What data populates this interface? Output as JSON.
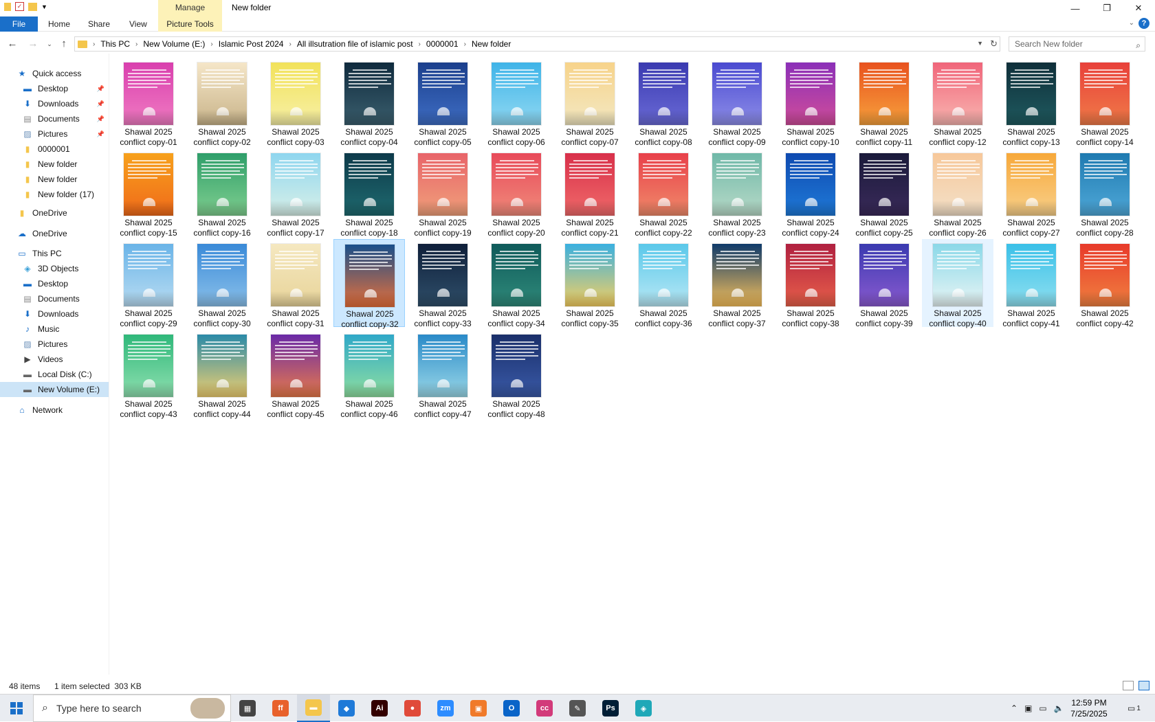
{
  "window": {
    "title": "New folder",
    "manage_label": "Manage",
    "controls": {
      "minimize": "—",
      "maximize": "❐",
      "close": "✕"
    }
  },
  "ribbon": {
    "tabs": [
      "File",
      "Home",
      "Share",
      "View"
    ],
    "picture_tools": "Picture Tools"
  },
  "address": {
    "segments": [
      "This PC",
      "New Volume (E:)",
      "Islamic Post 2024",
      "All illsutration file of islamic post",
      "0000001",
      "New folder"
    ]
  },
  "search": {
    "placeholder": "Search New folder"
  },
  "sidebar": {
    "items": [
      {
        "label": "Quick access",
        "icon": "star-icon",
        "pinned": false,
        "indent": 0
      },
      {
        "label": "Desktop",
        "icon": "desktop-icon",
        "pinned": true,
        "indent": 1
      },
      {
        "label": "Downloads",
        "icon": "download-icon",
        "pinned": true,
        "indent": 1
      },
      {
        "label": "Documents",
        "icon": "documents-icon",
        "pinned": true,
        "indent": 1
      },
      {
        "label": "Pictures",
        "icon": "pictures-icon",
        "pinned": true,
        "indent": 1
      },
      {
        "label": "0000001",
        "icon": "folder-icon",
        "pinned": false,
        "indent": 1
      },
      {
        "label": "New folder",
        "icon": "folder-icon",
        "pinned": false,
        "indent": 1
      },
      {
        "label": "New folder",
        "icon": "folder-icon",
        "pinned": false,
        "indent": 1
      },
      {
        "label": "New folder (17)",
        "icon": "folder-icon",
        "pinned": false,
        "indent": 1
      },
      {
        "label": "OneDrive",
        "icon": "folder-icon",
        "pinned": false,
        "indent": 0
      },
      {
        "label": "OneDrive",
        "icon": "cloud-icon",
        "pinned": false,
        "indent": 0
      },
      {
        "label": "This PC",
        "icon": "computer-icon",
        "pinned": false,
        "indent": 0
      },
      {
        "label": "3D Objects",
        "icon": "cube-icon",
        "pinned": false,
        "indent": 1
      },
      {
        "label": "Desktop",
        "icon": "desktop-icon",
        "pinned": false,
        "indent": 1
      },
      {
        "label": "Documents",
        "icon": "documents-icon",
        "pinned": false,
        "indent": 1
      },
      {
        "label": "Downloads",
        "icon": "download-icon",
        "pinned": false,
        "indent": 1
      },
      {
        "label": "Music",
        "icon": "music-icon",
        "pinned": false,
        "indent": 1
      },
      {
        "label": "Pictures",
        "icon": "pictures-icon",
        "pinned": false,
        "indent": 1
      },
      {
        "label": "Videos",
        "icon": "video-icon",
        "pinned": false,
        "indent": 1
      },
      {
        "label": "Local Disk (C:)",
        "icon": "drive-icon",
        "pinned": false,
        "indent": 1
      },
      {
        "label": "New Volume (E:)",
        "icon": "drive-icon",
        "pinned": false,
        "indent": 1
      },
      {
        "label": "Network",
        "icon": "network-icon",
        "pinned": false,
        "indent": 0
      }
    ],
    "selected_index": 20
  },
  "files": {
    "line1": "Shawal 2025",
    "names": [
      "conflict copy-01",
      "conflict copy-02",
      "conflict copy-03",
      "conflict copy-04",
      "conflict copy-05",
      "conflict copy-06",
      "conflict copy-07",
      "conflict copy-08",
      "conflict copy-09",
      "conflict copy-10",
      "conflict copy-11",
      "conflict copy-12",
      "conflict copy-13",
      "conflict copy-14",
      "conflict copy-15",
      "conflict copy-16",
      "conflict copy-17",
      "conflict copy-18",
      "conflict copy-19",
      "conflict copy-20",
      "conflict copy-21",
      "conflict copy-22",
      "conflict copy-23",
      "conflict copy-24",
      "conflict copy-25",
      "conflict copy-26",
      "conflict copy-27",
      "conflict copy-28",
      "conflict copy-29",
      "conflict copy-30",
      "conflict copy-31",
      "conflict copy-32",
      "conflict copy-33",
      "conflict copy-34",
      "conflict copy-35",
      "conflict copy-36",
      "conflict copy-37",
      "conflict copy-38",
      "conflict copy-39",
      "conflict copy-40",
      "conflict copy-41",
      "conflict copy-42",
      "conflict copy-43",
      "conflict copy-44",
      "conflict copy-45",
      "conflict copy-46",
      "conflict copy-47",
      "conflict copy-48"
    ],
    "colors": [
      [
        "#d93fae",
        "#f07bc2"
      ],
      [
        "#f5e6c8",
        "#c9b48a"
      ],
      [
        "#f2e25a",
        "#f7f0a6"
      ],
      [
        "#0f2a3d",
        "#3b5f6e"
      ],
      [
        "#1b3f8c",
        "#3e6dc4"
      ],
      [
        "#3fb4e8",
        "#8fd8f2"
      ],
      [
        "#f7d38a",
        "#f3e8c2"
      ],
      [
        "#3a3ab0",
        "#6a6ad6"
      ],
      [
        "#4a4ad0",
        "#8d8de8"
      ],
      [
        "#8b2fb8",
        "#d04d9a"
      ],
      [
        "#e8521e",
        "#f7a13c"
      ],
      [
        "#f0657a",
        "#f9b5b0"
      ],
      [
        "#0f2f3a",
        "#1f5a5f"
      ],
      [
        "#e8403a",
        "#f07b48"
      ],
      [
        "#f7a11c",
        "#f06a1a"
      ],
      [
        "#2f9e6a",
        "#7fcf8f"
      ],
      [
        "#8fd6ef",
        "#d8f0e8"
      ],
      [
        "#0d3a4a",
        "#1f6a6f"
      ],
      [
        "#e8646a",
        "#f0a07a"
      ],
      [
        "#e84a5a",
        "#f08a7a"
      ],
      [
        "#d8304a",
        "#f06a6a"
      ],
      [
        "#e8404a",
        "#f08a6a"
      ],
      [
        "#6fb8a8",
        "#b8dac8"
      ],
      [
        "#0f4ab0",
        "#1f7ad8"
      ],
      [
        "#1a1a3a",
        "#3a2a5a"
      ],
      [
        "#f7c89a",
        "#f3e0c8"
      ],
      [
        "#f7a83a",
        "#f8d08a"
      ],
      [
        "#1f7ab0",
        "#4fa8d8"
      ],
      [
        "#6ab4e8",
        "#b8dcf2"
      ],
      [
        "#3a8ad8",
        "#8ac0ea"
      ],
      [
        "#f5e8c0",
        "#e8d49a"
      ],
      [
        "#1a4f8a",
        "#e8703a"
      ],
      [
        "#0f1f3a",
        "#2f4f6a"
      ],
      [
        "#0f5a5a",
        "#2f8a7a"
      ],
      [
        "#3ab0e0",
        "#f7d060"
      ],
      [
        "#5ac8ea",
        "#b8e8f5"
      ],
      [
        "#0f3a6a",
        "#f7c05a"
      ],
      [
        "#b02040",
        "#e8604a"
      ],
      [
        "#3a3ab0",
        "#8a5ad0"
      ],
      [
        "#8ad8e8",
        "#e8f5f5"
      ],
      [
        "#3ac0e8",
        "#8fe0f0"
      ],
      [
        "#e83a2a",
        "#f08040"
      ],
      [
        "#2fb87a",
        "#8fe0b0"
      ],
      [
        "#2a8aa8",
        "#f0d070"
      ],
      [
        "#6a2aa8",
        "#e87a4a"
      ],
      [
        "#2fa8c8",
        "#8fe0a0"
      ],
      [
        "#2a8ac8",
        "#9ad8e8"
      ],
      [
        "#1a2f6a",
        "#3a5aa8"
      ]
    ],
    "selected_index": 31,
    "hover_index": 39
  },
  "status": {
    "count": "48 items",
    "selection": "1 item selected  303 KB"
  },
  "taskbar": {
    "search_placeholder": "Type here to search",
    "apps": [
      {
        "name": "task-view",
        "glyph": "▦",
        "color": "#444"
      },
      {
        "name": "firefox",
        "glyph": "ff",
        "color": "#e8612c"
      },
      {
        "name": "file-explorer",
        "glyph": "▬",
        "color": "#f4c64c"
      },
      {
        "name": "vscode",
        "glyph": "◆",
        "color": "#1f7ad8"
      },
      {
        "name": "illustrator",
        "glyph": "Ai",
        "color": "#330000"
      },
      {
        "name": "chrome",
        "glyph": "●",
        "color": "#e04a3a"
      },
      {
        "name": "zoom",
        "glyph": "zm",
        "color": "#2d8cff"
      },
      {
        "name": "app-orange",
        "glyph": "▣",
        "color": "#f07a2a"
      },
      {
        "name": "outlook",
        "glyph": "O",
        "color": "#0a64c8"
      },
      {
        "name": "creative-cloud",
        "glyph": "cc",
        "color": "#d23a7a"
      },
      {
        "name": "pen-tool",
        "glyph": "✎",
        "color": "#555"
      },
      {
        "name": "photoshop",
        "glyph": "Ps",
        "color": "#001e36"
      },
      {
        "name": "app-teal",
        "glyph": "◈",
        "color": "#1fa8b8"
      }
    ],
    "time": "12:59 PM",
    "date": "7/25/2025",
    "notification_count": "1"
  }
}
